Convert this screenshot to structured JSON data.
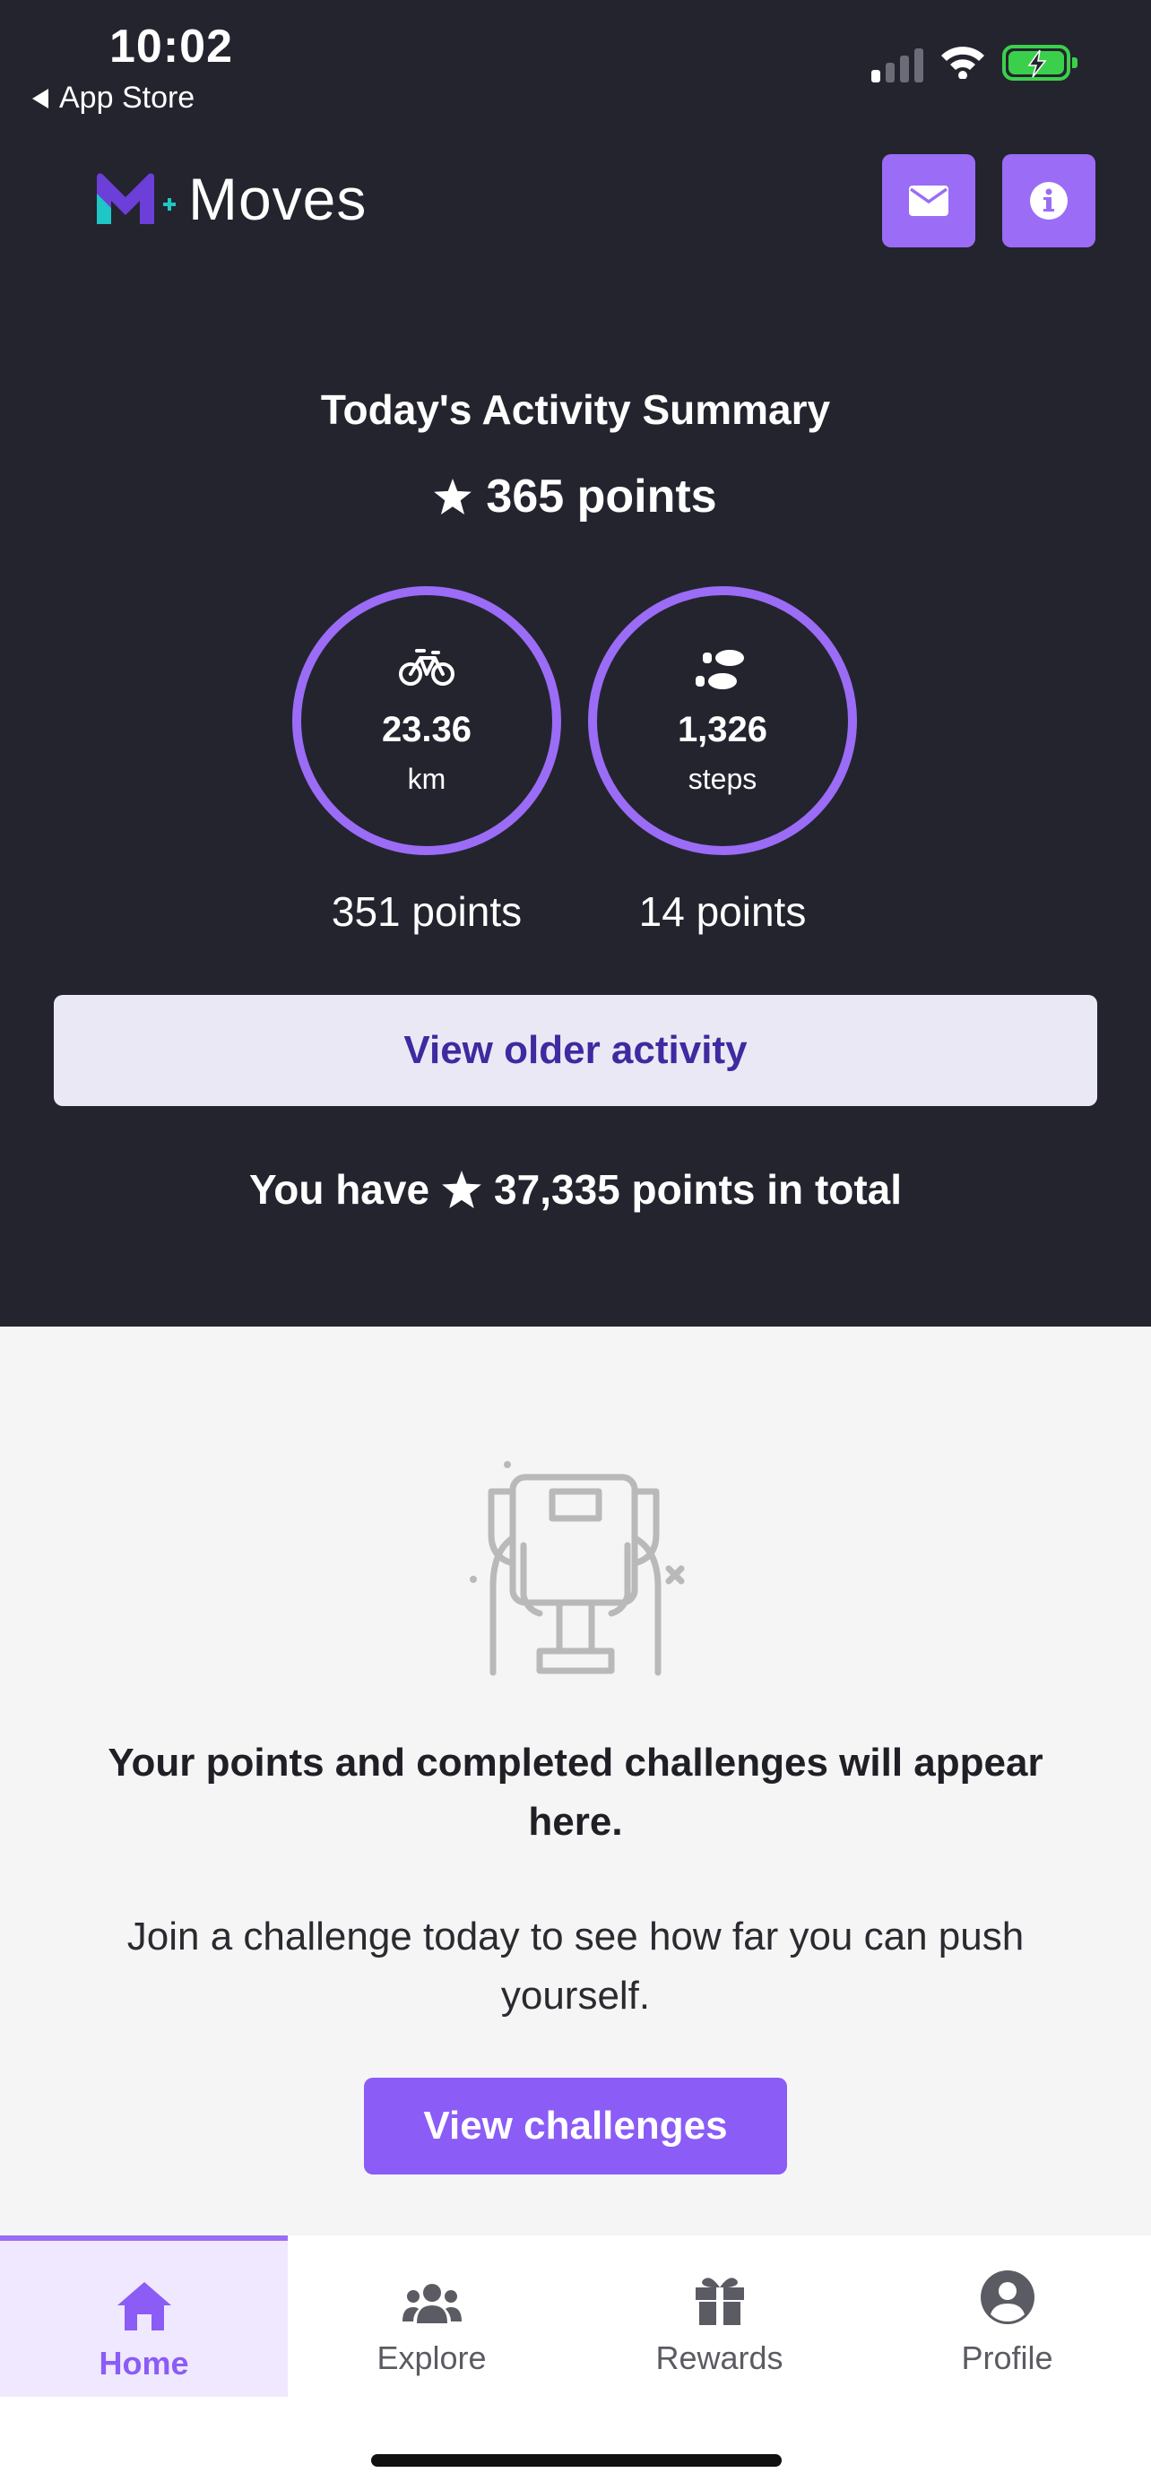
{
  "status_bar": {
    "time": "10:02",
    "back_label": "App Store"
  },
  "header": {
    "app_name": "Moves",
    "icons": [
      "envelope-icon",
      "info-icon"
    ]
  },
  "summary": {
    "title": "Today's Activity Summary",
    "points": "365 points",
    "activities": [
      {
        "icon": "bicycle-icon",
        "value": "23.36",
        "unit": "km",
        "points": "351 points"
      },
      {
        "icon": "footsteps-icon",
        "value": "1,326",
        "unit": "steps",
        "points": "14 points"
      }
    ],
    "older_button": "View older activity",
    "total_prefix": "You have",
    "total_suffix": "37,335 points in total"
  },
  "empty_state": {
    "icon": "trophy-icon",
    "title": "Your points and completed challenges will appear here.",
    "subtitle": "Join a challenge today to see how far you can push yourself.",
    "button": "View challenges"
  },
  "tabs": [
    {
      "label": "Home",
      "icon": "home-icon",
      "active": true
    },
    {
      "label": "Explore",
      "icon": "users-icon",
      "active": false
    },
    {
      "label": "Rewards",
      "icon": "gift-icon",
      "active": false
    },
    {
      "label": "Profile",
      "icon": "user-circle-icon",
      "active": false
    }
  ],
  "colors": {
    "hero_bg": "#24242f",
    "accent": "#9b6cf6",
    "button_light": "#ebe8f6",
    "body_bg": "#f5f5f5"
  }
}
